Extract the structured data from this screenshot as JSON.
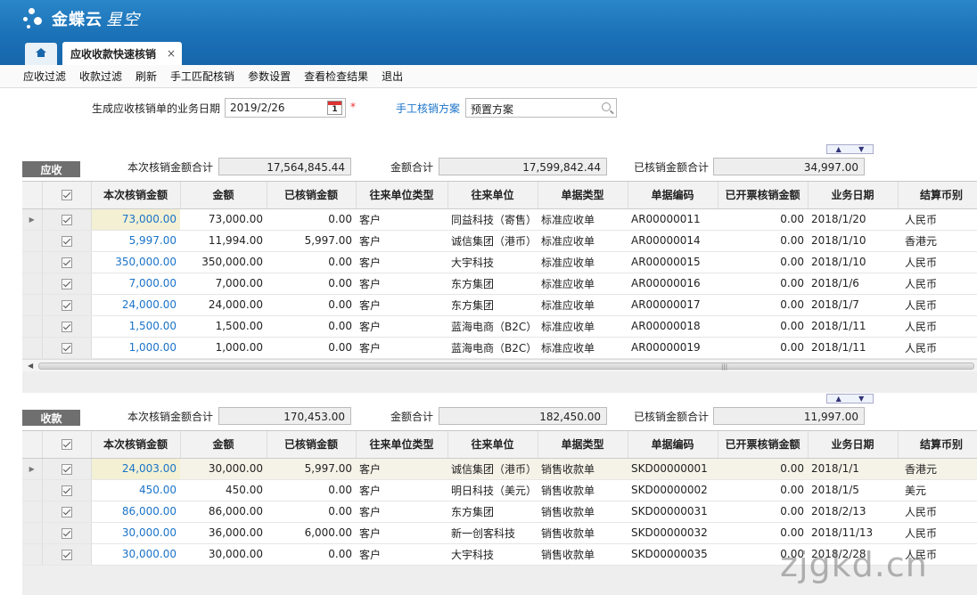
{
  "app": {
    "logo_text": "金蝶云",
    "logo_sub": "星空"
  },
  "tabs": {
    "active_label": "应收收款快速核销",
    "close": "×"
  },
  "toolbar": [
    "应收过滤",
    "收款过滤",
    "刷新",
    "手工匹配核销",
    "参数设置",
    "查看检查结果",
    "退出"
  ],
  "date_row": {
    "date_label": "生成应收核销单的业务日期",
    "date_value": "2019/2/26",
    "calendar_day": "1",
    "required_mark": "*",
    "scheme_label": "手工核销方案",
    "scheme_value": "预置方案"
  },
  "receivable": {
    "tag": "应收",
    "sum1_label": "本次核销金额合计",
    "sum1_value": "17,564,845.44",
    "sum2_label": "金额合计",
    "sum2_value": "17,599,842.44",
    "sum3_label": "已核销金额合计",
    "sum3_value": "34,997.00",
    "rows": [
      [
        "73,000.00",
        "73,000.00",
        "0.00",
        "客户",
        "同益科技（寄售）",
        "标准应收单",
        "AR00000011",
        "0.00",
        "2018/1/20",
        "人民币"
      ],
      [
        "5,997.00",
        "11,994.00",
        "5,997.00",
        "客户",
        "诚信集团（港币）",
        "标准应收单",
        "AR00000014",
        "0.00",
        "2018/1/10",
        "香港元"
      ],
      [
        "350,000.00",
        "350,000.00",
        "0.00",
        "客户",
        "大宇科技",
        "标准应收单",
        "AR00000015",
        "0.00",
        "2018/1/10",
        "人民币"
      ],
      [
        "7,000.00",
        "7,000.00",
        "0.00",
        "客户",
        "东方集团",
        "标准应收单",
        "AR00000016",
        "0.00",
        "2018/1/6",
        "人民币"
      ],
      [
        "24,000.00",
        "24,000.00",
        "0.00",
        "客户",
        "东方集团",
        "标准应收单",
        "AR00000017",
        "0.00",
        "2018/1/7",
        "人民币"
      ],
      [
        "1,500.00",
        "1,500.00",
        "0.00",
        "客户",
        "蓝海电商（B2C）",
        "标准应收单",
        "AR00000018",
        "0.00",
        "2018/1/11",
        "人民币"
      ],
      [
        "1,000.00",
        "1,000.00",
        "0.00",
        "客户",
        "蓝海电商（B2C）",
        "标准应收单",
        "AR00000019",
        "0.00",
        "2018/1/11",
        "人民币"
      ]
    ]
  },
  "payment": {
    "tag": "收款",
    "sum1_label": "本次核销金额合计",
    "sum1_value": "170,453.00",
    "sum2_label": "金额合计",
    "sum2_value": "182,450.00",
    "sum3_label": "已核销金额合计",
    "sum3_value": "11,997.00",
    "rows": [
      [
        "24,003.00",
        "30,000.00",
        "5,997.00",
        "客户",
        "诚信集团（港币）",
        "销售收款单",
        "SKD00000001",
        "0.00",
        "2018/1/1",
        "香港元"
      ],
      [
        "450.00",
        "450.00",
        "0.00",
        "客户",
        "明日科技（美元）",
        "销售收款单",
        "SKD00000002",
        "0.00",
        "2018/1/5",
        "美元"
      ],
      [
        "86,000.00",
        "86,000.00",
        "0.00",
        "客户",
        "东方集团",
        "销售收款单",
        "SKD00000031",
        "0.00",
        "2018/2/13",
        "人民币"
      ],
      [
        "30,000.00",
        "36,000.00",
        "6,000.00",
        "客户",
        "新一创客科技",
        "销售收款单",
        "SKD00000032",
        "0.00",
        "2018/11/13",
        "人民币"
      ],
      [
        "30,000.00",
        "30,000.00",
        "0.00",
        "客户",
        "大宇科技",
        "销售收款单",
        "SKD00000035",
        "0.00",
        "2018/2/28",
        "人民币"
      ]
    ]
  },
  "columns": [
    "本次核销金额",
    "金额",
    "已核销金额",
    "往来单位类型",
    "往来单位",
    "单据类型",
    "单据编码",
    "已开票核销金额",
    "业务日期",
    "结算币别"
  ],
  "watermark": "zjgkd.cn"
}
